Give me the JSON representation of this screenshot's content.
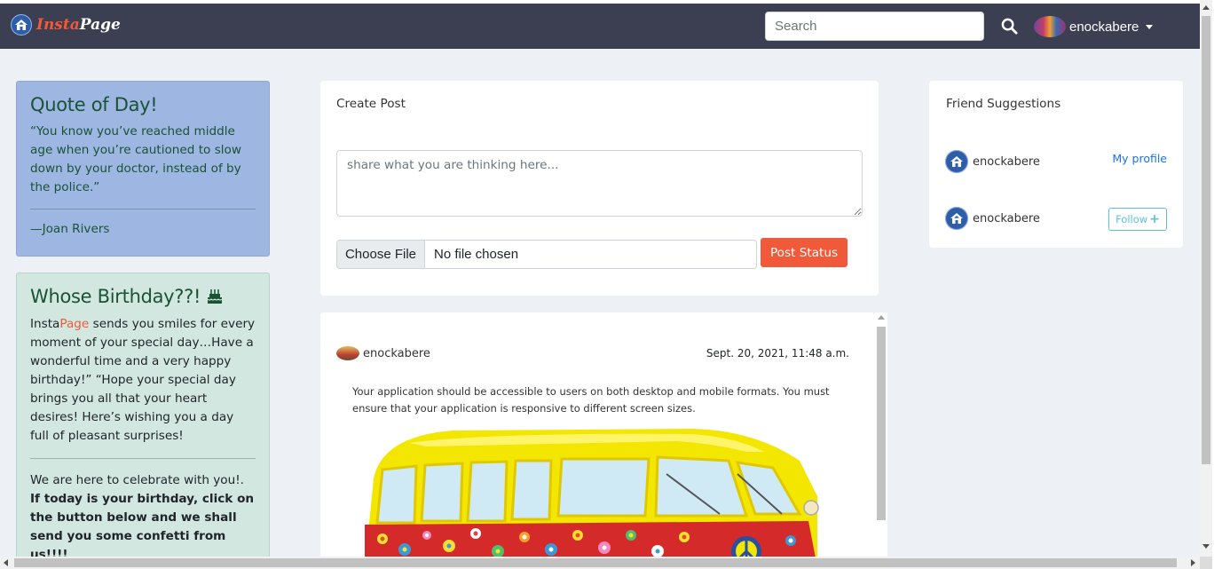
{
  "navbar": {
    "brand_insta": "Insta",
    "brand_page": "Page",
    "logo_icon": "home-icon",
    "search_placeholder": "Search",
    "search_icon": "search-icon",
    "username": "enockabere",
    "colors": {
      "background": "#3b3f51",
      "accent": "#f0593a"
    }
  },
  "quote": {
    "title": "Quote of Day!",
    "text": "“You know you’ve reached middle age when you’re cautioned to slow down by your doctor, instead of by the police.”",
    "author": "—Joan Rivers",
    "colors": {
      "background": "#9eb6e2",
      "text": "#1a5236"
    }
  },
  "birthday": {
    "title": "Whose Birthday??!",
    "cake_icon": "cake-icon",
    "text_prefix": "Insta",
    "text_accent": "Page",
    "text_body": " sends you smiles for every moment of your special day…Have a wonderful time and a very happy birthday!” “Hope your special day brings you all that your heart desires! Here’s wishing you a day full of pleasant surprises!",
    "celebrate": "We are here to celebrate with you!.",
    "instruction": "If today is your birthday, click on the button below and we shall send you some confetti from us!!!!",
    "colors": {
      "background": "#d2e7df"
    }
  },
  "create_post": {
    "title": "Create Post",
    "textarea_placeholder": "share what you are thinking here...",
    "choose_file_label": "Choose File",
    "file_status": "No file chosen",
    "post_button_label": "Post Status"
  },
  "feed": {
    "post": {
      "username": "enockabere",
      "date": "Sept. 20, 2021, 11:48 a.m.",
      "text": "Your application should be accessible to users on both desktop and mobile formats. You must ensure that your application is responsive to different screen sizes.",
      "image": "hippie-van-image"
    }
  },
  "friends": {
    "title": "Friend Suggestions",
    "items": [
      {
        "name": "enockabere",
        "action": "My profile"
      },
      {
        "name": "enockabere",
        "action": "Follow"
      }
    ],
    "follow_icon": "plus-icon"
  }
}
